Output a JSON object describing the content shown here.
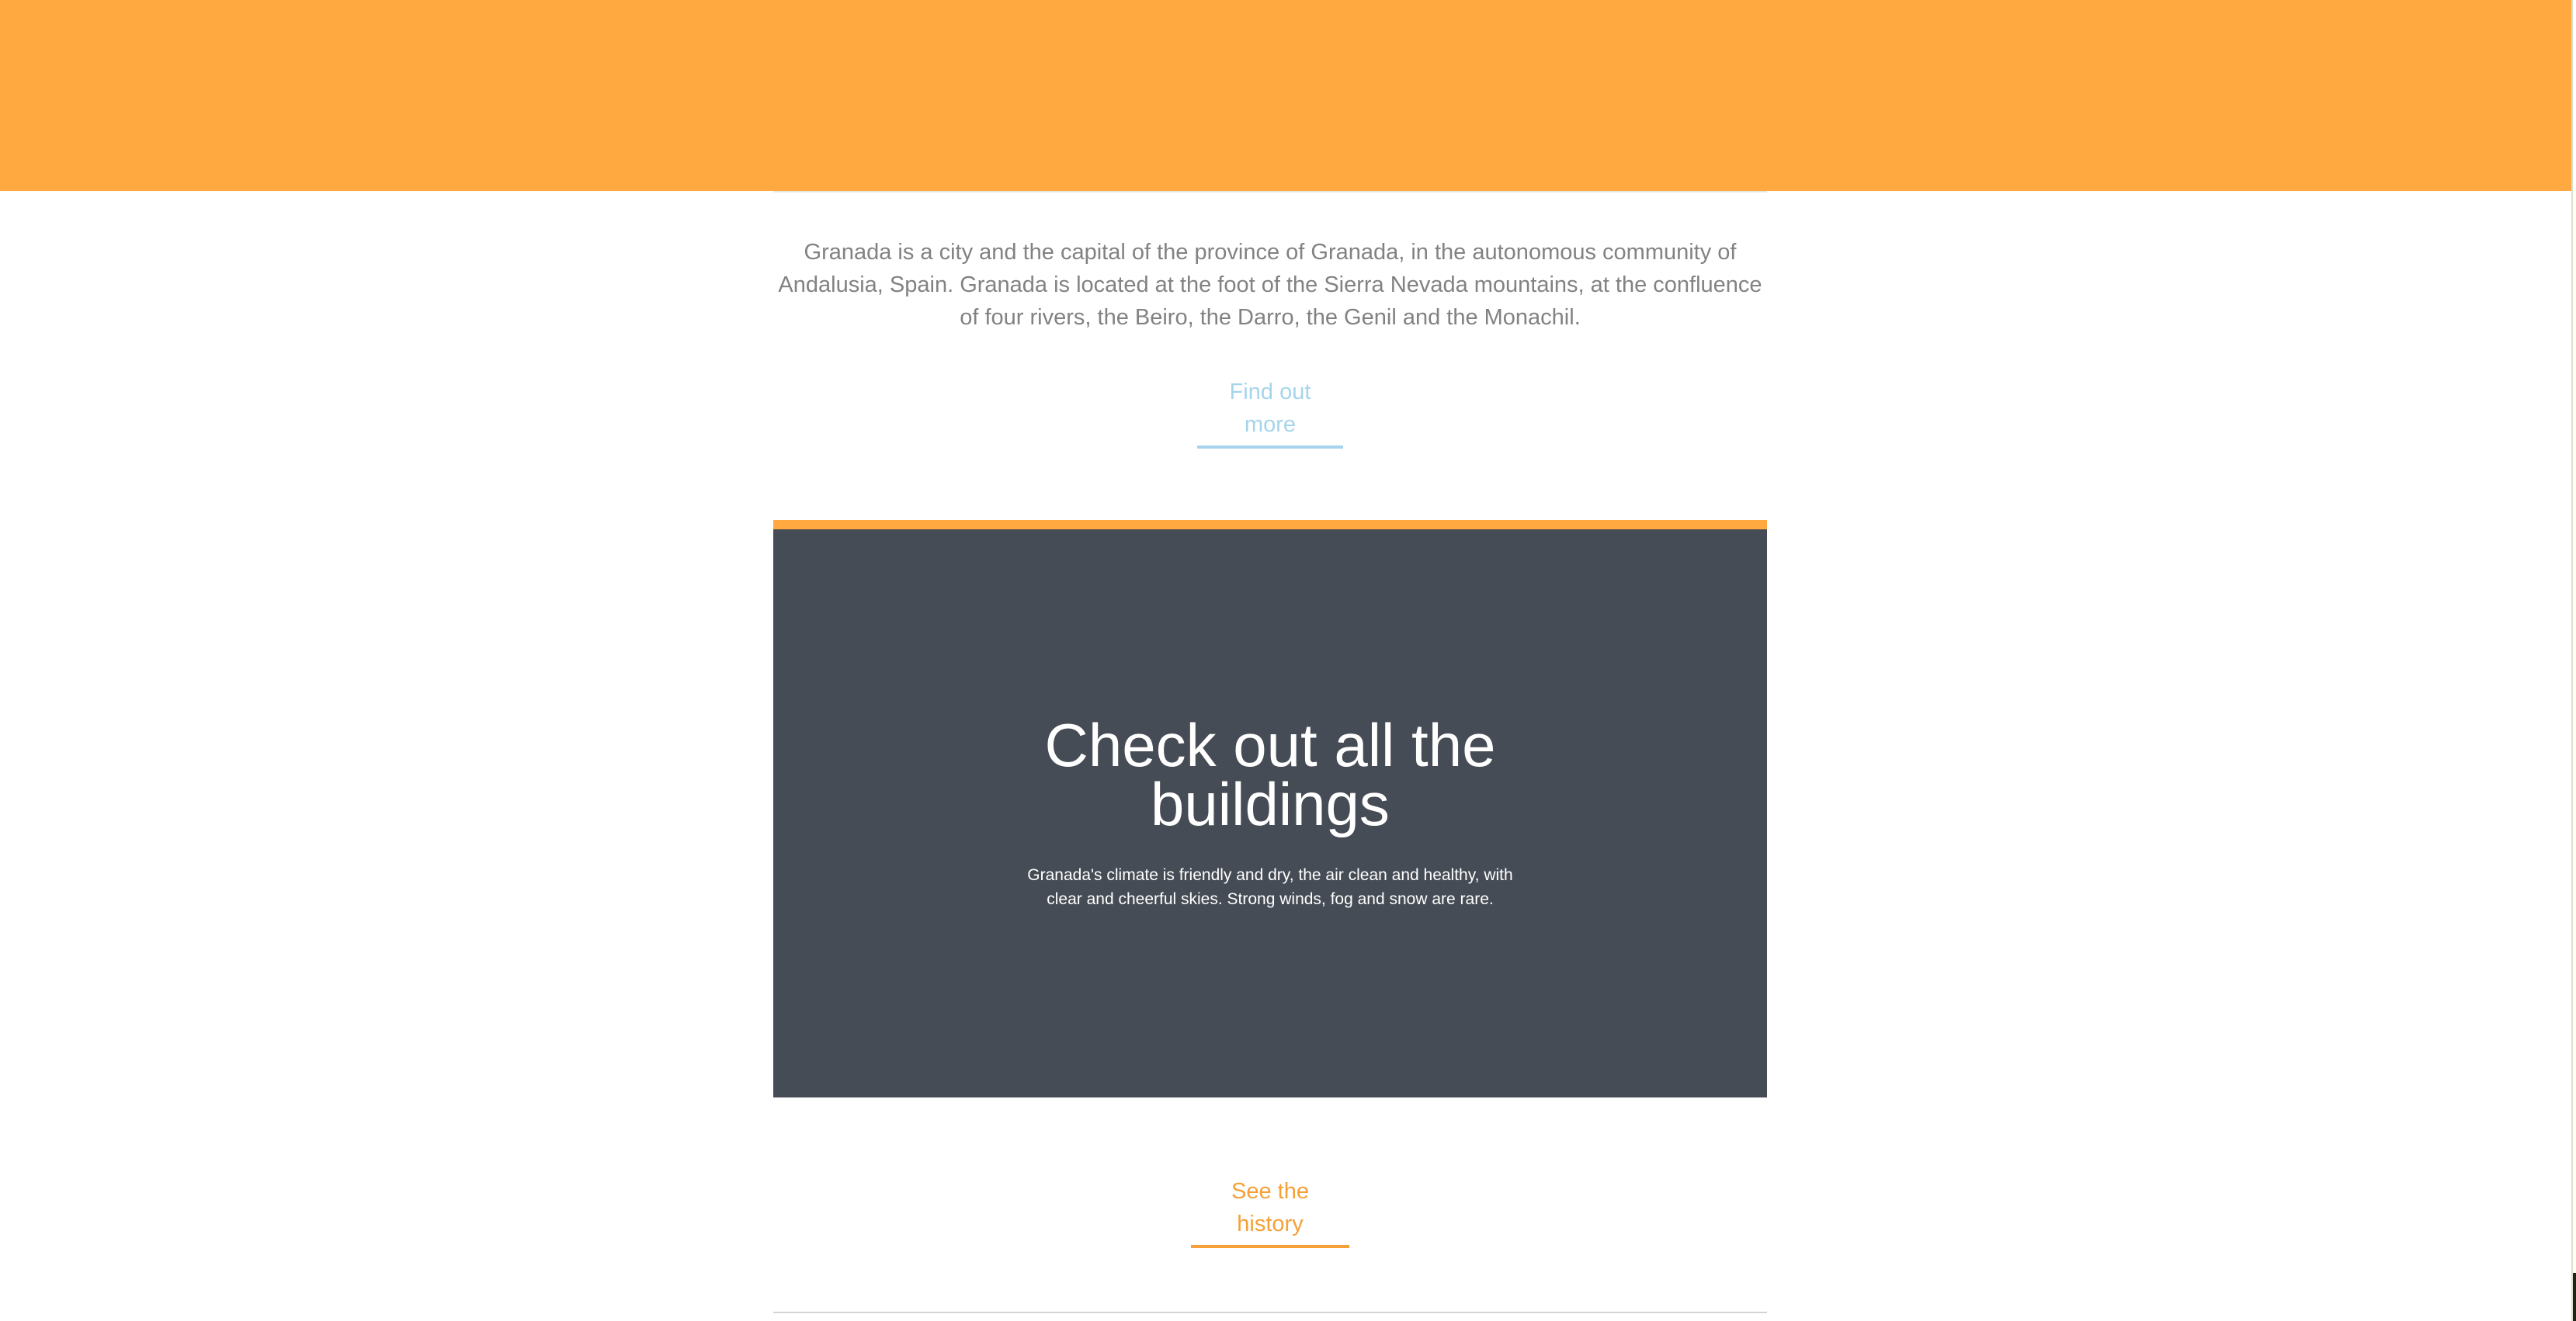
{
  "intro": {
    "text": "Granada is a city and the capital of the province of Granada, in the autonomous community of Andalusia, Spain. Granada is located at the foot of the Sierra Nevada mountains, at the confluence of four rivers, the Beiro, the Darro, the Genil and the Monachil.",
    "link_label": "Find out more"
  },
  "feature": {
    "title": "Check out all the buildings",
    "text": "Granada's climate is friendly and dry, the air clean and healthy, with clear and cheerful skies. Strong winds, fog and snow are rare."
  },
  "history": {
    "link_label": "See the history"
  },
  "colors": {
    "accent": "#ffa940",
    "feature_bg": "#464c55",
    "body_text": "#828282",
    "link_blue": "#a6d4ec",
    "link_orange": "#f5a038"
  }
}
